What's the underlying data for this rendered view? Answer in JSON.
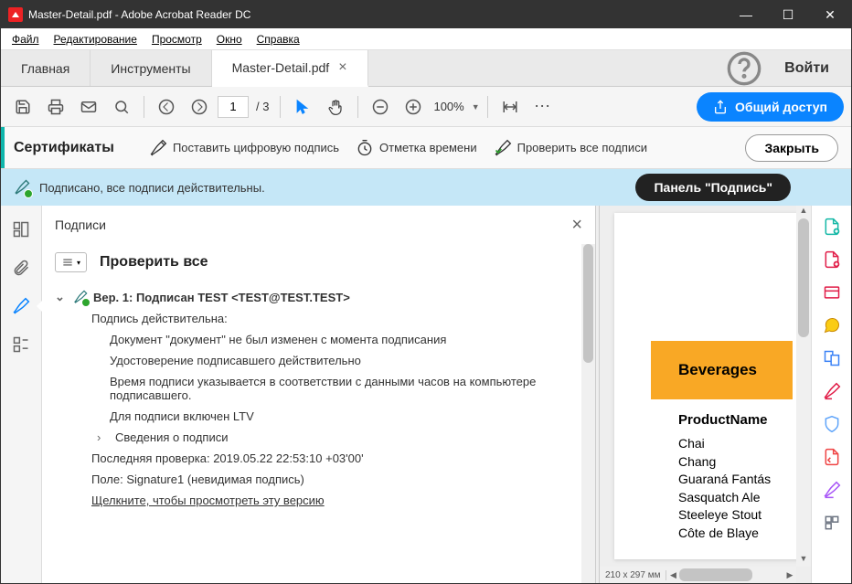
{
  "titlebar": {
    "title": "Master-Detail.pdf - Adobe Acrobat Reader DC"
  },
  "menu": {
    "file": "Файл",
    "edit": "Редактирование",
    "view": "Просмотр",
    "window": "Окно",
    "help": "Справка"
  },
  "tabs": {
    "home": "Главная",
    "tools": "Инструменты",
    "doc": "Master-Detail.pdf",
    "signin": "Войти"
  },
  "toolbar": {
    "page_current": "1",
    "page_total": "/ 3",
    "zoom": "100%",
    "share": "Общий доступ"
  },
  "certbar": {
    "title": "Сертификаты",
    "sign": "Поставить цифровую подпись",
    "timestamp": "Отметка времени",
    "verify": "Проверить все подписи",
    "close": "Закрыть"
  },
  "sigbanner": {
    "text": "Подписано, все подписи действительны.",
    "panel_btn": "Панель \"Подпись\""
  },
  "sigpanel": {
    "header": "Подписи",
    "verify_all": "Проверить все",
    "version_line": "Вер. 1: Подписан TEST <TEST@TEST.TEST>",
    "valid_line": "Подпись действительна:",
    "doc_line": "Документ \"документ\" не был изменен с момента подписания",
    "cert_line": "Удостоверение подписавшего действительно",
    "time_line": "Время подписи указывается в соответствии с данными часов на компьютере подписавшего.",
    "ltv_line": "Для подписи включен LTV",
    "details_line": "Сведения о подписи",
    "lastcheck_line": "Последняя проверка: 2019.05.22 22:53:10 +03'00'",
    "field_line": "Поле: Signature1 (невидимая подпись)",
    "view_version": "Щелкните, чтобы просмотреть эту версию"
  },
  "doc": {
    "category": "Beverages",
    "col_header": "ProductName",
    "products": [
      "Chai",
      "Chang",
      "Guaraná Fantás",
      "Sasquatch Ale",
      "Steeleye Stout",
      "Côte de Blaye"
    ],
    "dimensions": "210 x 297 мм"
  }
}
